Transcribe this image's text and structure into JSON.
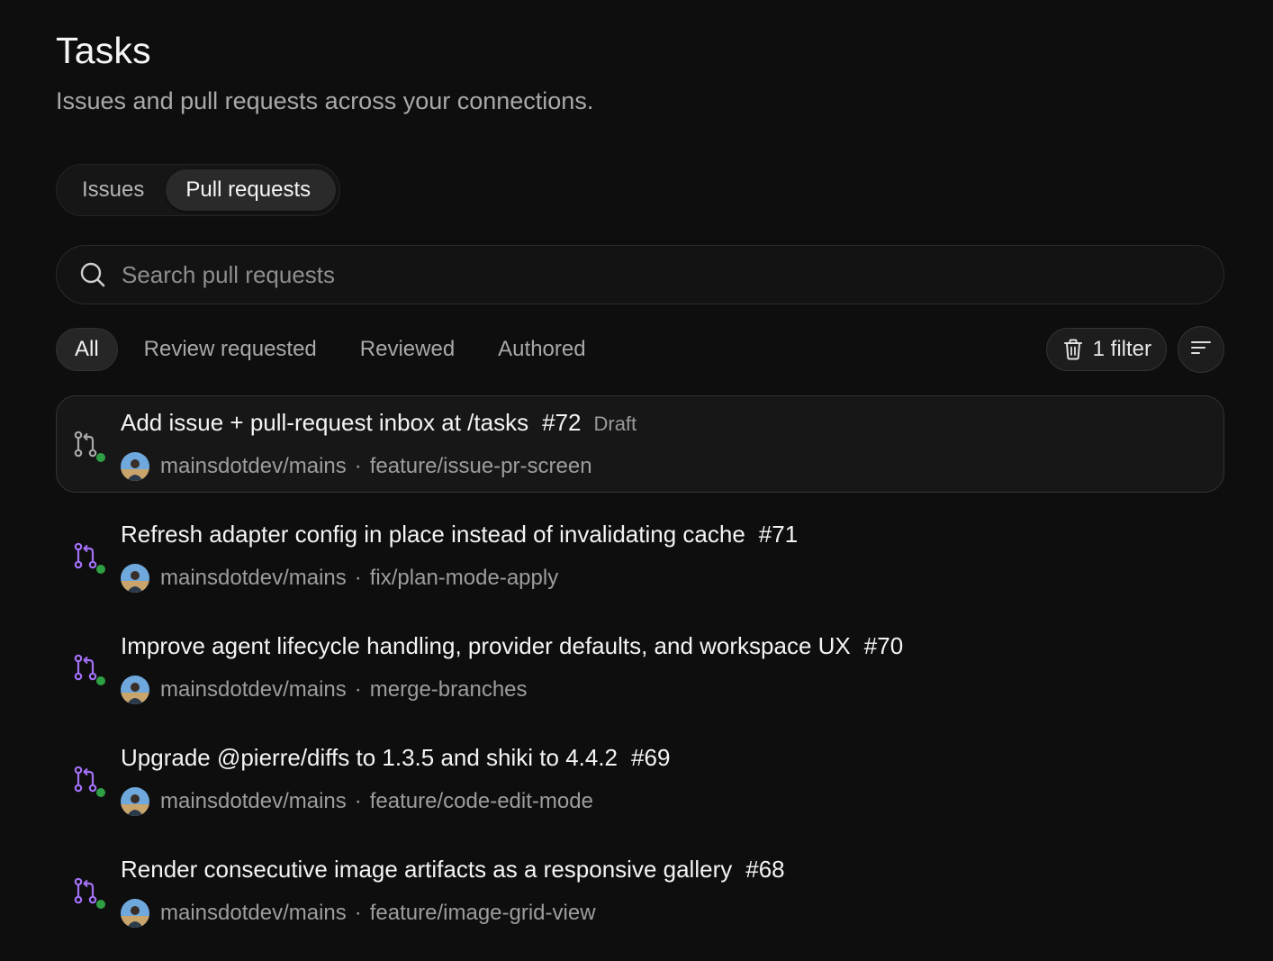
{
  "header": {
    "title": "Tasks",
    "subtitle": "Issues and pull requests across your connections."
  },
  "tabs": [
    {
      "label": "Issues",
      "active": false
    },
    {
      "label": "Pull requests",
      "active": true
    }
  ],
  "search": {
    "placeholder": "Search pull requests",
    "value": ""
  },
  "filters": {
    "chips": [
      {
        "label": "All",
        "active": true
      },
      {
        "label": "Review requested",
        "active": false
      },
      {
        "label": "Reviewed",
        "active": false
      },
      {
        "label": "Authored",
        "active": false
      }
    ],
    "filter_button_label": "1 filter",
    "filter_icon": "trash-icon",
    "sort_icon": "sort-icon"
  },
  "colors": {
    "background": "#0e0e0e",
    "pr_open_purple": "#a371f7",
    "pr_draft_gray": "#9a9a9a",
    "status_green": "#2ea043"
  },
  "pull_requests": [
    {
      "title": "Add issue + pull-request inbox at /tasks",
      "number": "#72",
      "draft": "Draft",
      "repo": "mainsdotdev/mains",
      "separator": "·",
      "branch": "feature/issue-pr-screen",
      "selected": true,
      "state_icon": "git-pull-request-draft-icon"
    },
    {
      "title": "Refresh adapter config in place instead of invalidating cache",
      "number": "#71",
      "draft": "",
      "repo": "mainsdotdev/mains",
      "separator": "·",
      "branch": "fix/plan-mode-apply",
      "selected": false,
      "state_icon": "git-pull-request-icon"
    },
    {
      "title": "Improve agent lifecycle handling, provider defaults, and workspace UX",
      "number": "#70",
      "draft": "",
      "repo": "mainsdotdev/mains",
      "separator": "·",
      "branch": "merge-branches",
      "selected": false,
      "state_icon": "git-pull-request-icon"
    },
    {
      "title": "Upgrade @pierre/diffs to 1.3.5 and shiki to 4.4.2",
      "number": "#69",
      "draft": "",
      "repo": "mainsdotdev/mains",
      "separator": "·",
      "branch": "feature/code-edit-mode",
      "selected": false,
      "state_icon": "git-pull-request-icon"
    },
    {
      "title": "Render consecutive image artifacts as a responsive gallery",
      "number": "#68",
      "draft": "",
      "repo": "mainsdotdev/mains",
      "separator": "·",
      "branch": "feature/image-grid-view",
      "selected": false,
      "state_icon": "git-pull-request-icon"
    }
  ]
}
